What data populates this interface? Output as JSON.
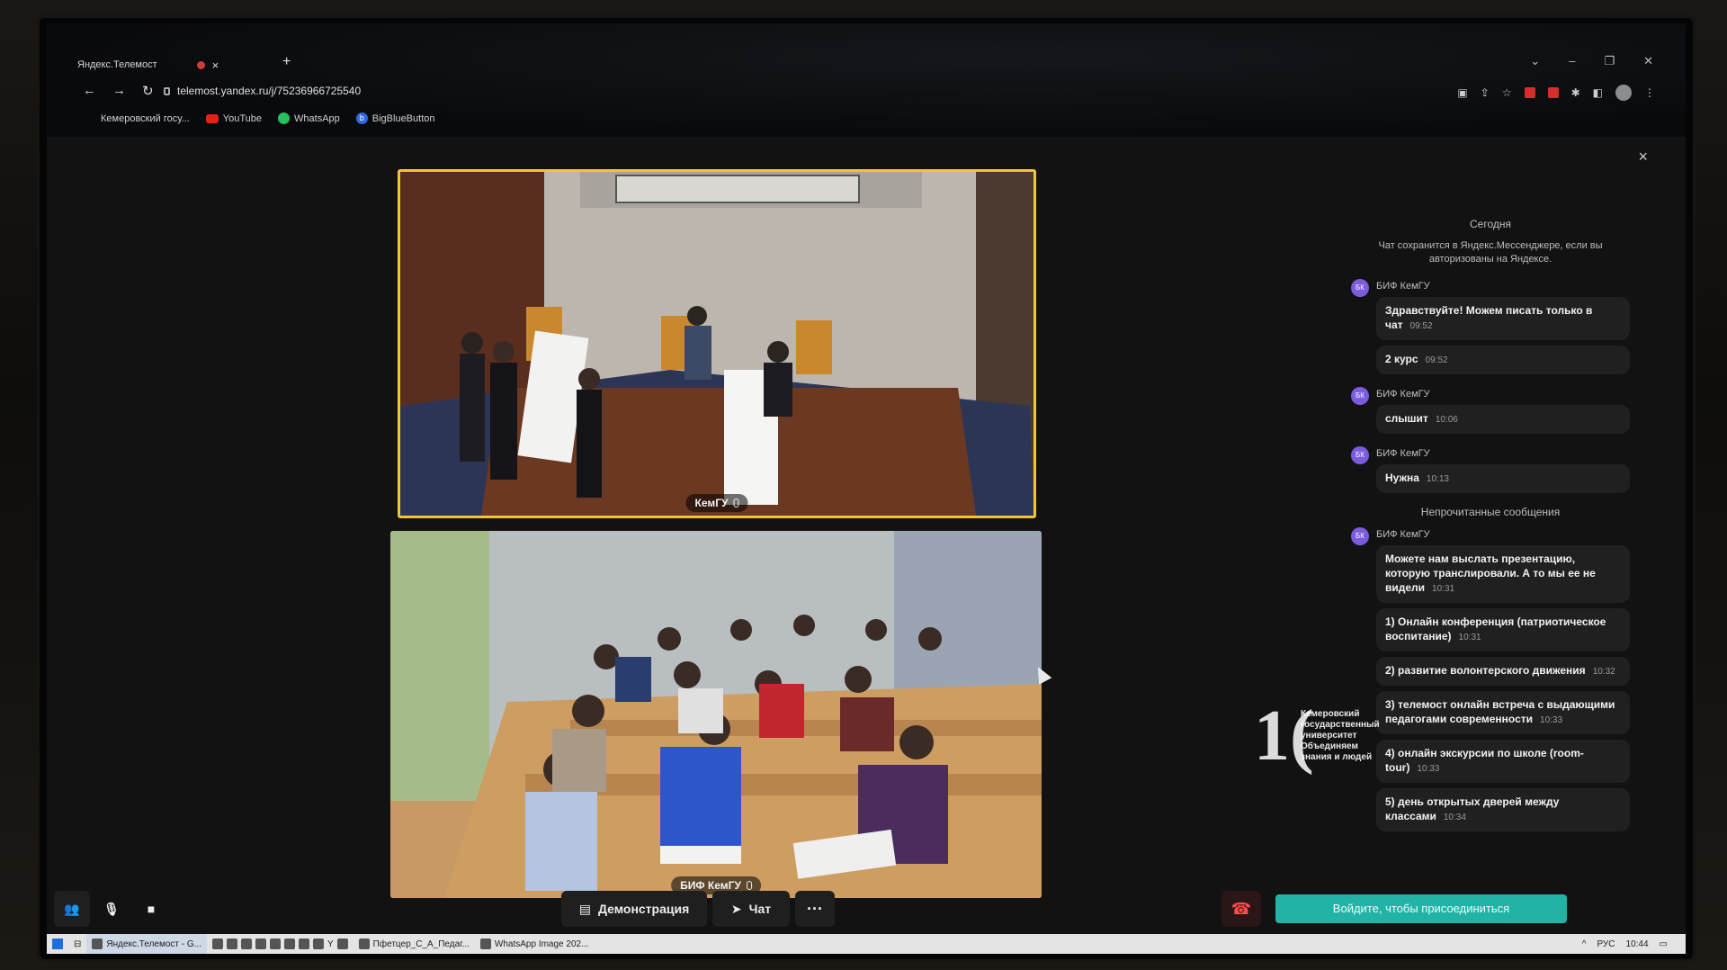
{
  "browser": {
    "tab_title": "Яндекс.Телемост",
    "tab_close": "×",
    "new_tab": "+",
    "url": "telemost.yandex.ru/j/75236966725540",
    "bookmarks": [
      "Кемеровский госу...",
      "YouTube",
      "WhatsApp",
      "BigBlueButton"
    ]
  },
  "videos": [
    {
      "label": "КемГУ"
    },
    {
      "label": "БИФ КемГУ"
    }
  ],
  "chat": {
    "close": "×",
    "date": "Сегодня",
    "note": "Чат сохранится в Яндекс.Мессенджере, если вы авторизованы на Яндексе.",
    "avatar": "БК",
    "unread_label": "Непрочитанные сообщения",
    "groups": [
      {
        "author": "БИФ КемГУ",
        "messages": [
          {
            "text": "Здравствуйте! Можем писать только в чат",
            "time": "09:52"
          },
          {
            "text": "2 курс",
            "time": "09:52"
          }
        ]
      },
      {
        "author": "БИФ КемГУ",
        "messages": [
          {
            "text": "слышит",
            "time": "10:06"
          }
        ]
      },
      {
        "author": "БИФ КемГУ",
        "messages": [
          {
            "text": "Нужна",
            "time": "10:13"
          }
        ]
      }
    ],
    "unread_group": {
      "author": "БИФ КемГУ",
      "messages": [
        {
          "text": "Можете нам выслать презентацию, которую транслировали. А то мы ее не видели",
          "time": "10:31"
        },
        {
          "text": "1) Онлайн конференция (патриотическое воспитание)",
          "time": "10:31"
        },
        {
          "text": "2) развитие волонтерского движения",
          "time": "10:32"
        },
        {
          "text": "3) телемост онлайн встреча с выдающими педагогами современности",
          "time": "10:33"
        },
        {
          "text": "4) онлайн экскурсии по школе (room-tour)",
          "time": "10:33"
        },
        {
          "text": "5) день открытых дверей между классами",
          "time": "10:34"
        }
      ]
    }
  },
  "controls": {
    "demo_label": "Демонстрация",
    "chat_label": "Чат",
    "more_label": "···",
    "join_label": "Войдите, чтобы присоединиться"
  },
  "watermark": {
    "mark": "1(",
    "line1": "Кемеровский",
    "line2": "государственный",
    "line3": "университет",
    "line4": "Объединяем",
    "line5": "знания и людей"
  },
  "taskbar": {
    "items": [
      "Яндекс.Телемост - G...",
      "Пфетцер_С_А_Педаг...",
      "WhatsApp Image 202..."
    ],
    "lang": "РУС",
    "time": "10:44"
  }
}
